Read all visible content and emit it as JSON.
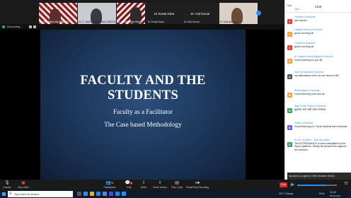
{
  "gallery": {
    "tiles": [
      {
        "label": "Dr. Shraddha Vay Wadekar"
      },
      {
        "label": "Dr. S. Tabir Faisal (Senior) SMCDS"
      },
      {
        "label": "Dr. Ameet Yusuf Khan"
      }
    ],
    "name_tiles": [
      {
        "name": "Dr Sonali Saha",
        "label": "Dr Sonali Saha"
      },
      {
        "name": "Dr. Atul Kumar",
        "label": "Dr. Atul Kumar"
      }
    ],
    "last_tile": {
      "label": "Dr Saurabh Rao"
    }
  },
  "share_bar": {
    "recording": "Recording..."
  },
  "slide": {
    "title_line1": "FACULTY AND THE",
    "title_line2": "STUDENTS",
    "subtitle1": "Faculty as a Facilitator",
    "subtitle2": "The Case based Methodology"
  },
  "chat": {
    "title": "Chat",
    "hide_label": "Hide",
    "messages": [
      {
        "from": "Jenn",
        "text": "",
        "avatar": "J",
        "color": "#7b5cd6"
      },
      {
        "from": "I Jender to Everyone",
        "text": "yes ma'am",
        "avatar": "I",
        "color": "#d94a3b"
      },
      {
        "from": "Lalitpati Kholmi to Everyone",
        "text": "good morning sir",
        "avatar": "L",
        "color": "#f2a33b"
      },
      {
        "from": "I Jender to Everyone",
        "text": "good morning sir",
        "avatar": "I",
        "color": "#d94a3b"
      },
      {
        "from": "Dr. Nilupam Kumar Magal to Everyone",
        "text": "Good morning to you all.",
        "avatar": "D",
        "color": "#f2a33b"
      },
      {
        "from": "Anku A/I Mudala to Everyone",
        "text": "my attendance form do we need to fill?",
        "avatar": "A",
        "color": "#555555"
      },
      {
        "from": "Rinki Ayaska to Everyone",
        "text": "Good Morning one and all",
        "avatar": "R",
        "color": "#f2a33b"
      },
      {
        "from": "Rajsi Kumar Tiwari to Everyone",
        "text": "सुप्रभात आप सभी सादर नमस्कार",
        "avatar": "R",
        "color": "#3aa36a"
      },
      {
        "from": "Seeta to Everyone",
        "text": "Good Morning Dr. Sonli Saxena from Mumbai",
        "avatar": "S",
        "color": "#7b5cd6"
      },
      {
        "from": "Dr. AK.. to AMKU... from all profiles",
        "text": "The ATTENDANCE is auto calculated by the Zoom platform. Kindly be present throughout the session.",
        "avatar": "D",
        "color": "#3aa36a"
      }
    ]
  },
  "toolbar": {
    "items": [
      {
        "label": "Unmute",
        "icon": "microphone-icon"
      },
      {
        "label": "Stop Video",
        "icon": "video-icon"
      },
      {
        "label": "Participants",
        "icon": "participants-icon"
      },
      {
        "label": "Chat",
        "icon": "chat-icon"
      },
      {
        "label": "Share",
        "icon": "share-icon"
      },
      {
        "label": "Share Screen",
        "icon": "share-screen-icon"
      },
      {
        "label": "Polls / Quiz",
        "icon": "polls-icon"
      },
      {
        "label": "Pause/Stop Recording",
        "icon": "record-icon"
      }
    ],
    "participants_count": "91",
    "chat_badge": "2",
    "end_label": "End",
    "volume_value": "72",
    "volume_fraction": 0.72,
    "speaker_tip": "Speakers (Logitech USB Headset H340)"
  },
  "taskbar": {
    "search_placeholder": "Type here to search",
    "weather": "29°C Cloudy",
    "language": "ENG",
    "time": "10:42",
    "date": "08-09-2021"
  }
}
